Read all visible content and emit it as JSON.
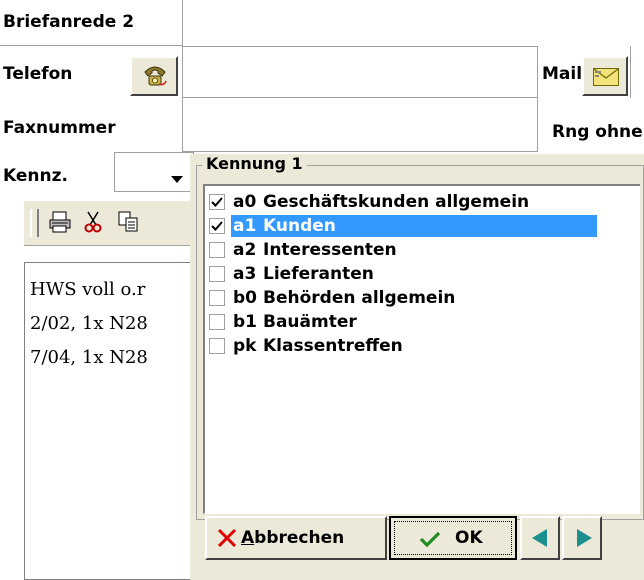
{
  "form": {
    "briefanrede_label": "Briefanrede 2",
    "telefon_label": "Telefon",
    "faxnummer_label": "Faxnummer",
    "kennz_label": "Kennz.",
    "mail_label": "Mail",
    "rng_label": "Rng ohne"
  },
  "memo": {
    "lines": [
      "HWS voll o.r",
      "2/02, 1x N28",
      "7/04, 1x N28"
    ]
  },
  "popup": {
    "group_title": "Kennung 1",
    "items": [
      {
        "code": "a0",
        "label": "Geschäftskunden allgemein",
        "checked": true,
        "selected": false
      },
      {
        "code": "a1",
        "label": "Kunden",
        "checked": true,
        "selected": true
      },
      {
        "code": "a2",
        "label": "Interessenten",
        "checked": false,
        "selected": false
      },
      {
        "code": "a3",
        "label": "Lieferanten",
        "checked": false,
        "selected": false
      },
      {
        "code": "b0",
        "label": "Behörden allgemein",
        "checked": false,
        "selected": false
      },
      {
        "code": "b1",
        "label": "Bauämter",
        "checked": false,
        "selected": false
      },
      {
        "code": "pk",
        "label": "Klassentreffen",
        "checked": false,
        "selected": false
      }
    ],
    "cancel_label_accel": "A",
    "cancel_label_rest": "bbrechen",
    "ok_label": "OK"
  },
  "colors": {
    "selection": "#3399ff",
    "ok_check": "#1e8c1e",
    "nav_arrow": "#1c8f8f",
    "cancel_x": "#e00000"
  }
}
